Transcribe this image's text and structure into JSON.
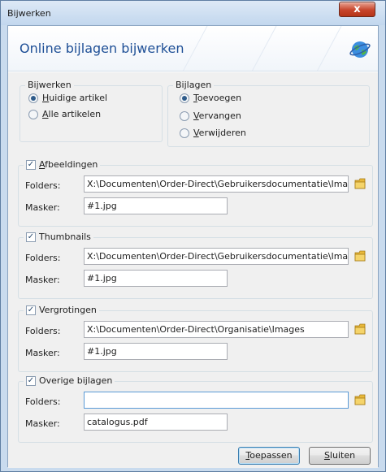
{
  "window": {
    "title": "Bijwerken",
    "close_glyph": "x"
  },
  "header": {
    "title": "Online bijlagen bijwerken",
    "icon": "globe-icon"
  },
  "bijwerken": {
    "legend": "Bijwerken",
    "options": [
      {
        "label": "Huidige artikel",
        "accel": "H",
        "rest": "uidige artikel",
        "checked": true
      },
      {
        "label": "Alle artikelen",
        "accel": "A",
        "rest": "lle artikelen",
        "checked": false
      }
    ]
  },
  "bijlagen": {
    "legend": "Bijlagen",
    "options": [
      {
        "label": "Toevoegen",
        "accel": "T",
        "rest": "oevoegen",
        "checked": true
      },
      {
        "label": "Vervangen",
        "accel": "V",
        "rest": "ervangen",
        "checked": false
      },
      {
        "label": "Verwijderen",
        "accel": "V",
        "rest": "erwijderen",
        "checked": false
      }
    ]
  },
  "labels": {
    "folders": "Folders:",
    "masker": "Masker:"
  },
  "groups": [
    {
      "title": "Afbeeldingen",
      "accel": "A",
      "rest": "fbeeldingen",
      "checked": true,
      "folder": "X:\\Documenten\\Order-Direct\\Gebruikersdocumentatie\\Ima",
      "mask": "#1.jpg"
    },
    {
      "title": "Thumbnails",
      "accel": "",
      "rest": "Thumbnails",
      "checked": true,
      "folder": "X:\\Documenten\\Order-Direct\\Gebruikersdocumentatie\\Ima",
      "mask": "#1.jpg"
    },
    {
      "title": "Vergrotingen",
      "accel": "",
      "rest": "Vergrotingen",
      "checked": true,
      "folder": "X:\\Documenten\\Order-Direct\\Organisatie\\Images",
      "mask": "#1.jpg"
    },
    {
      "title": "Overige bijlagen",
      "accel": "",
      "rest": "Overige bijlagen",
      "checked": true,
      "folder": "",
      "mask": "catalogus.pdf"
    }
  ],
  "buttons": {
    "apply": {
      "label": "Toepassen",
      "accel": "T",
      "rest": "oepassen"
    },
    "close": {
      "label": "Sluiten",
      "accel": "S",
      "rest": "luiten"
    }
  },
  "colors": {
    "accent": "#1e4f96",
    "folder_icon": "#e8b83a",
    "close_button": "#c7452b"
  }
}
